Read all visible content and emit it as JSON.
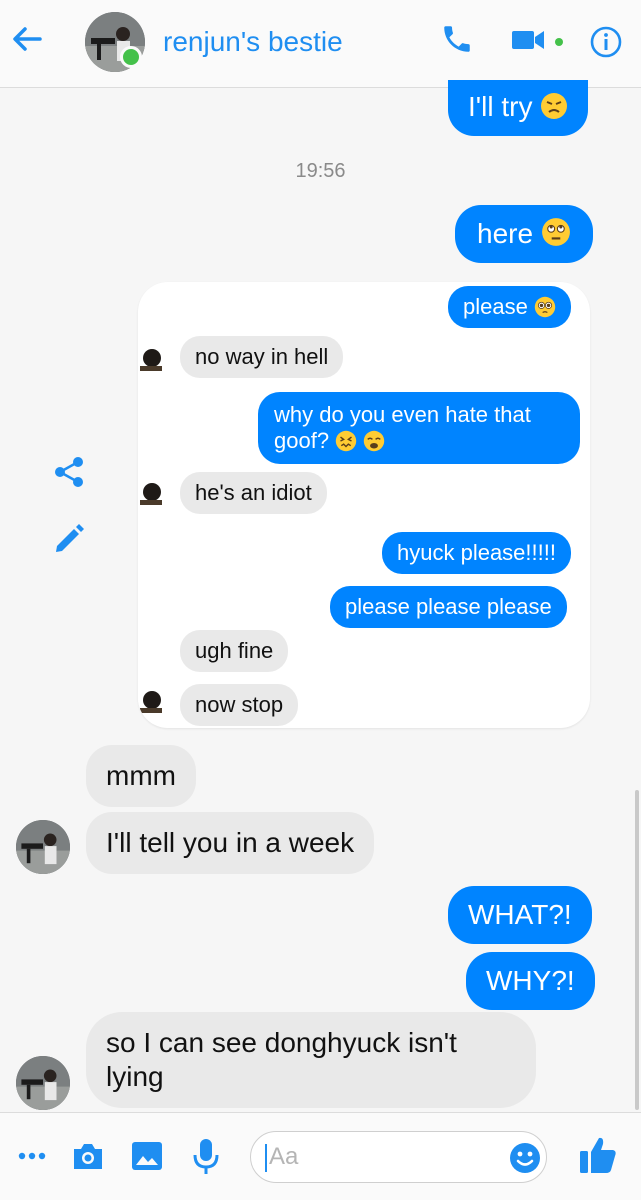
{
  "header": {
    "contact_name": "renjun's bestie",
    "status": "online",
    "accent": "#1f8ef1",
    "icons": [
      "back-arrow-icon",
      "phone-icon",
      "video-camera-icon",
      "info-icon"
    ]
  },
  "messages": {
    "m1": "I'll try",
    "time": "19:56",
    "m2": "here",
    "m3": "mmm",
    "m4": "I'll tell you in a week",
    "m5": "WHAT?!",
    "m6": "WHY?!",
    "m7_line1": "so I can see donghyuck isn't",
    "m7_line2": "lying"
  },
  "shared_screenshot": {
    "s1": "please",
    "s2": "no way in hell",
    "s3_line1": "why do you even hate that",
    "s3_line2": "goof?",
    "s4": "he's an idiot",
    "s5": "hyuck please!!!!!",
    "s6": "please please please",
    "s7": "ugh fine",
    "s8": "now stop"
  },
  "side_actions": [
    "share-icon",
    "edit-pencil-icon"
  ],
  "composer": {
    "placeholder": "Aa",
    "icons": [
      "more-icon",
      "camera-icon",
      "image-icon",
      "microphone-icon",
      "emoji-icon",
      "thumbs-up-icon"
    ]
  },
  "colors": {
    "outgoing": "#0084ff",
    "incoming": "#e9e9e9",
    "online": "#44c14a"
  }
}
